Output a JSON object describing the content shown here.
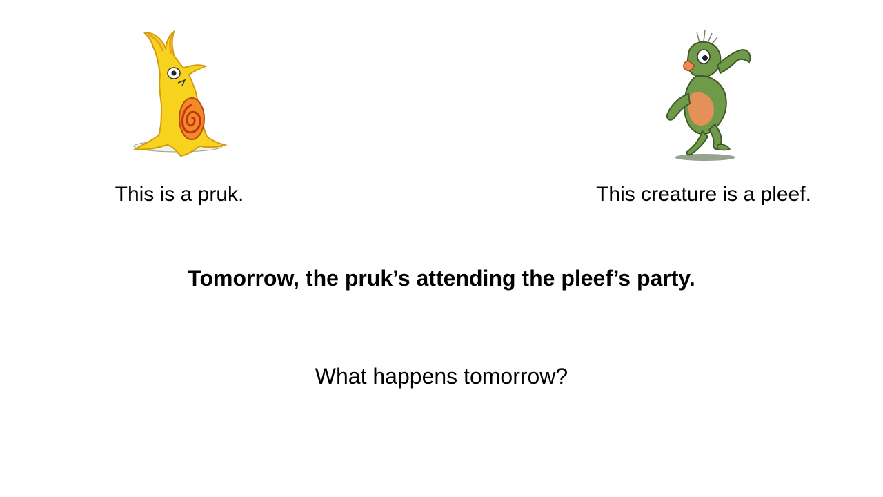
{
  "slide": {
    "pruk_caption": "This is a pruk.",
    "pleef_caption": "This creature is a pleef.",
    "statement": "Tomorrow, the pruk’s attending the pleef’s party.",
    "question": "What happens tomorrow?"
  },
  "illustrations": {
    "pruk": {
      "icon": "yellow-snail-creature-icon",
      "body_color": "#f7d31e",
      "spiral_color": "#e8641a"
    },
    "pleef": {
      "icon": "green-lizard-creature-icon",
      "body_color": "#6f9a4a",
      "belly_color": "#f0905a"
    }
  }
}
